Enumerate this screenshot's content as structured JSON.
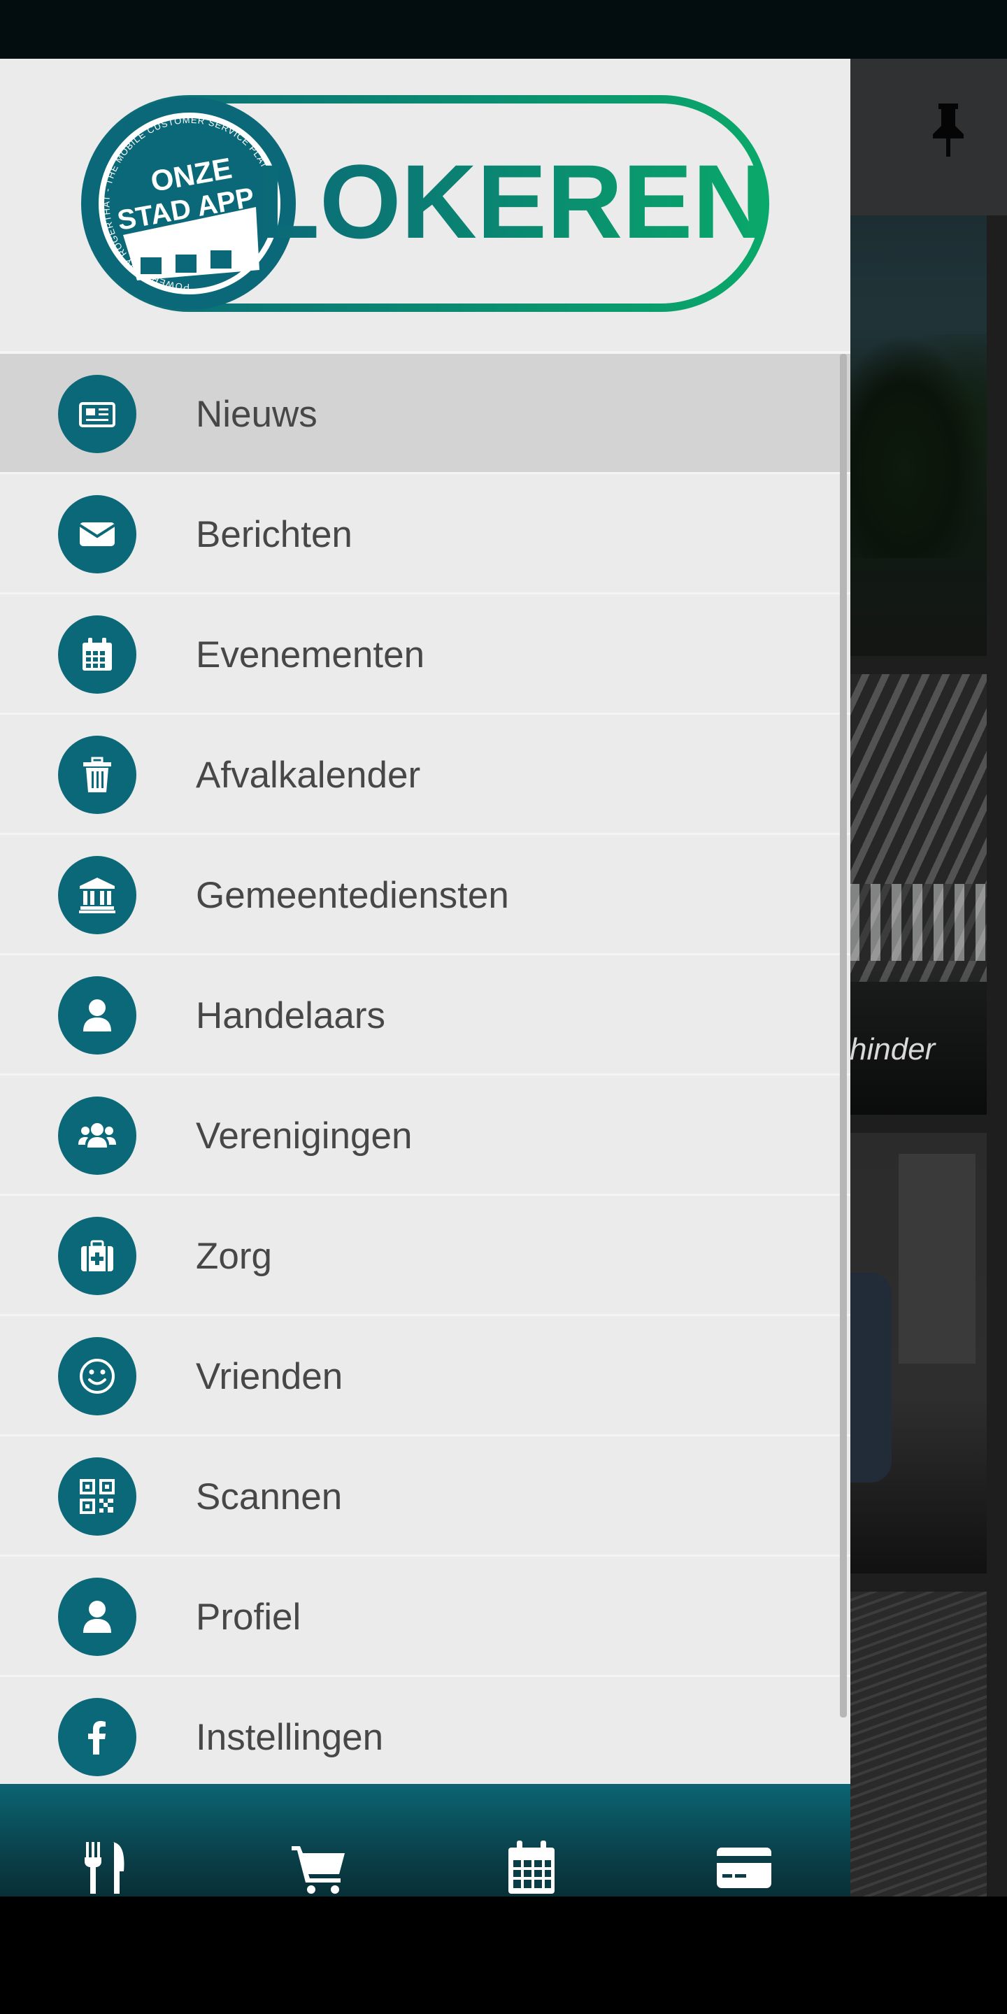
{
  "app": {
    "logo_badge_text": "ONZE STAD APP",
    "logo_ring_text": "POWERED BY ROGERTHAT - THE MOBILE CUSTOMER SERVICE PLATFORM",
    "city_name": "LOKEREN"
  },
  "drawer": {
    "items": [
      {
        "label": "Nieuws",
        "icon": "newspaper-icon",
        "active": true
      },
      {
        "label": "Berichten",
        "icon": "envelope-icon"
      },
      {
        "label": "Evenementen",
        "icon": "calendar-icon"
      },
      {
        "label": "Afvalkalender",
        "icon": "trash-icon"
      },
      {
        "label": "Gemeentediensten",
        "icon": "institution-icon"
      },
      {
        "label": "Handelaars",
        "icon": "user-icon"
      },
      {
        "label": "Verenigingen",
        "icon": "users-icon"
      },
      {
        "label": "Zorg",
        "icon": "medkit-icon"
      },
      {
        "label": "Vrienden",
        "icon": "smile-icon"
      },
      {
        "label": "Scannen",
        "icon": "qrcode-icon"
      },
      {
        "label": "Profiel",
        "icon": "user-icon"
      },
      {
        "label": "Instellingen",
        "icon": "facebook-icon"
      }
    ]
  },
  "tabbar": {
    "tabs": [
      "cutlery-icon",
      "shopping-cart-icon",
      "calendar-icon",
      "credit-card-icon"
    ]
  },
  "background": {
    "card_caption": "hinder",
    "pin_icon": "pin-icon"
  },
  "colors": {
    "accent": "#0b6878",
    "logo_green": "#0aa86a",
    "drawer_bg": "#ebebeb",
    "active_item_bg": "#d3d3d3"
  }
}
